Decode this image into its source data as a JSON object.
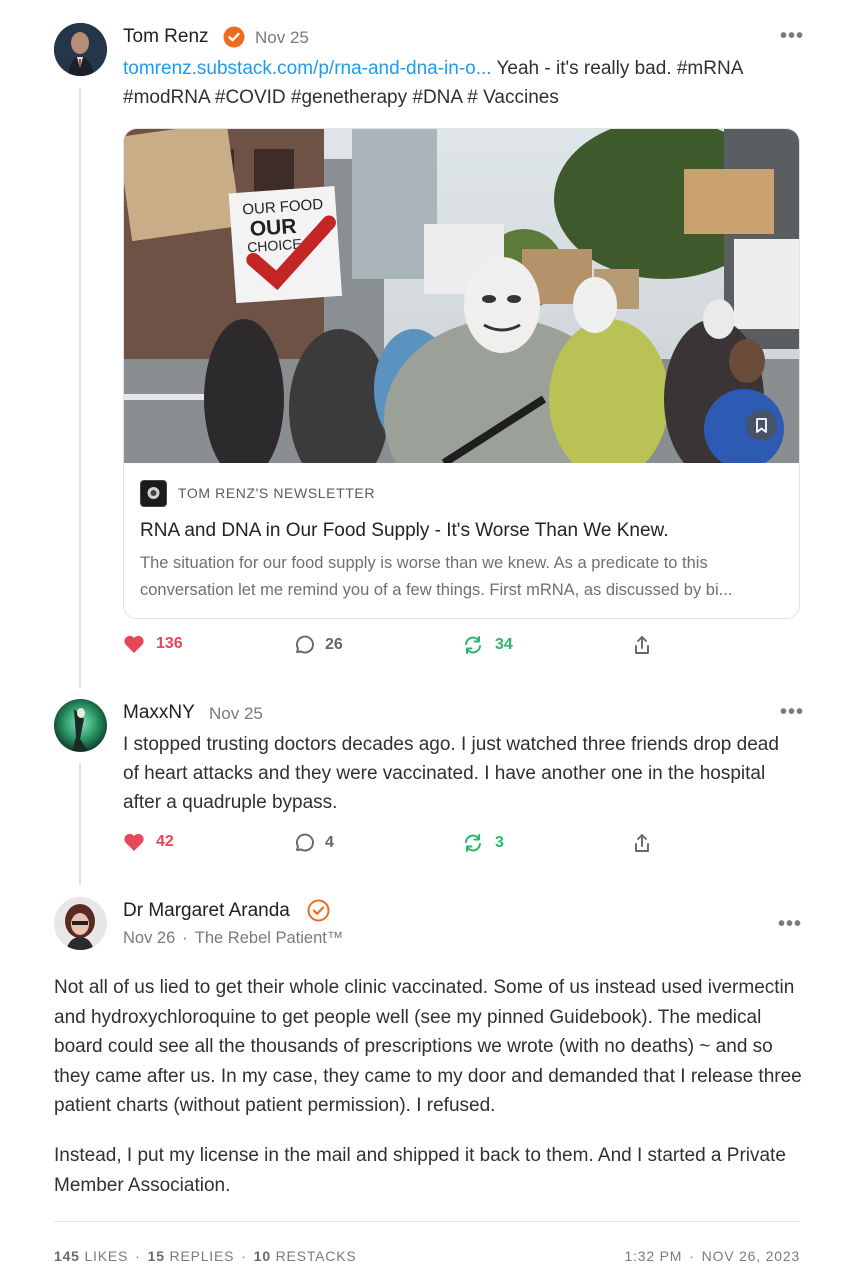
{
  "post1": {
    "author": "Tom Renz",
    "date": "Nov 25",
    "link_text": "tomrenz.substack.com/p/rna-and-dna-in-o...",
    "text_rest": " Yeah - it's really bad. #mRNA",
    "text_line2": "#modRNA #COVID #genetherapy #DNA # Vaccines",
    "card": {
      "publication": "TOM RENZ'S NEWSLETTER",
      "title": "RNA and DNA in Our Food Supply - It's Worse Than We Knew.",
      "description": "The situation for our food supply is worse than we knew. As a predicate to this conversation let me remind you of a few things. First mRNA, as discussed by bi...",
      "sign_text_1": "OUR FOOD",
      "sign_text_2": "OUR",
      "sign_text_3": "CHOICE"
    },
    "likes": "136",
    "comments": "26",
    "restacks": "34"
  },
  "post2": {
    "author": "MaxxNY",
    "date": "Nov 25",
    "text": "I stopped trusting doctors decades ago. I just watched three friends drop dead of heart attacks and they were vaccinated. I have another one in the hospital after a quadruple bypass.",
    "likes": "42",
    "comments": "4",
    "restacks": "3"
  },
  "post3": {
    "author": "Dr Margaret Aranda",
    "date": "Nov 26",
    "publication": "The Rebel Patient™",
    "para1": "Not all of us lied to get their whole clinic vaccinated. Some of us instead used ivermectin and hydroxychloroquine to get people well (see my pinned Guidebook). The medical board could see all the thousands of prescriptions we wrote (with no deaths) ~ and so they came after us. In my case, they came to my door and demanded that I release three patient charts (without patient permission). I refused.",
    "para2": "Instead, I put my license in the mail and shipped it back to them. And I started a Private Member Association."
  },
  "stats": {
    "likes_count": "145",
    "likes_label": "LIKES",
    "replies_count": "15",
    "replies_label": "REPLIES",
    "restacks_count": "10",
    "restacks_label": "RESTACKS",
    "time": "1:32 PM",
    "date": "NOV 26, 2023"
  },
  "colors": {
    "like": "#e8475a",
    "restack": "#2db56c",
    "link": "#1d9bf0",
    "verified": "#f26a1b"
  }
}
